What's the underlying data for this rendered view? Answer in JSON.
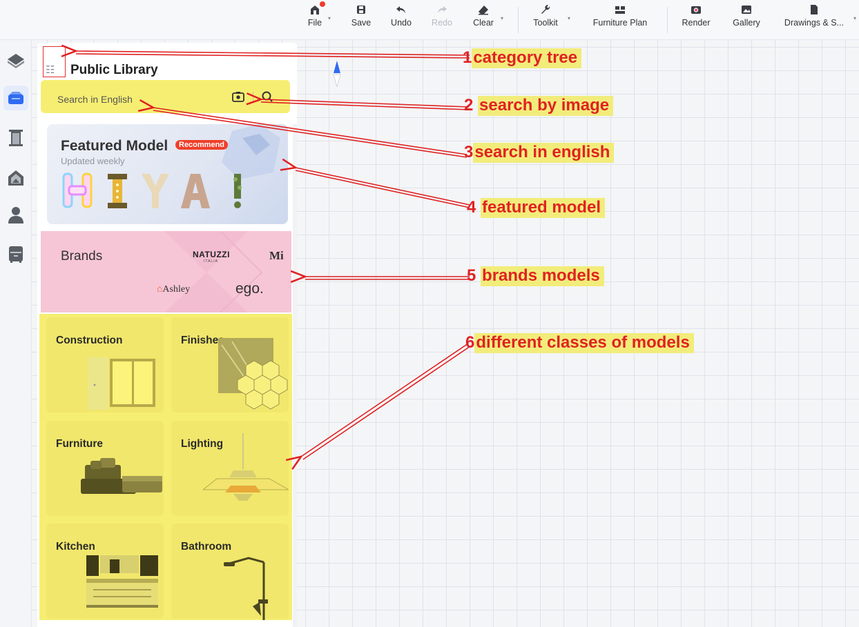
{
  "toolbar": {
    "items": [
      {
        "label": "File",
        "icon": "house-file-icon"
      },
      {
        "label": "Save",
        "icon": "floppy-save-icon"
      },
      {
        "label": "Undo",
        "icon": "undo-arrow-icon"
      },
      {
        "label": "Redo",
        "icon": "redo-arrow-icon",
        "disabled": true
      },
      {
        "label": "Clear",
        "icon": "eraser-icon"
      },
      {
        "label": "Toolkit",
        "icon": "wrench-icon"
      },
      {
        "label": "Furniture Plan",
        "icon": "plan-grid-icon"
      },
      {
        "label": "Render",
        "icon": "camera-icon"
      },
      {
        "label": "Gallery",
        "icon": "image-icon"
      },
      {
        "label": "Drawings & S...",
        "icon": "document-icon"
      }
    ]
  },
  "rail": {
    "items": [
      {
        "icon": "cube-shape-icon"
      },
      {
        "icon": "library-box-icon",
        "active": true
      },
      {
        "icon": "door-icon"
      },
      {
        "icon": "house-outline-icon"
      },
      {
        "icon": "person-icon"
      },
      {
        "icon": "cabinet-icon"
      }
    ]
  },
  "library": {
    "title": "Public Library",
    "search_placeholder": "Search in English",
    "featured": {
      "title": "Featured Model",
      "badge": "Recommend",
      "subtitle": "Updated weekly",
      "letters": [
        "H",
        "I",
        "Y",
        "A",
        "!"
      ]
    },
    "brands": {
      "title": "Brands",
      "logos": [
        "NATUZZI",
        "ITALIA",
        "Mi",
        "Ashley",
        "ego."
      ]
    },
    "categories": [
      {
        "label": "Construction"
      },
      {
        "label": "Finishes"
      },
      {
        "label": "Furniture"
      },
      {
        "label": "Lighting"
      },
      {
        "label": "Kitchen"
      },
      {
        "label": "Bathroom"
      }
    ]
  },
  "annotations": [
    {
      "num": "1",
      "text": "category tree"
    },
    {
      "num": "2",
      "text": "search by image"
    },
    {
      "num": "3",
      "text": "search in english"
    },
    {
      "num": "4",
      "text": "featured model"
    },
    {
      "num": "5",
      "text": "brands models"
    },
    {
      "num": "6",
      "text": "different classes of models"
    }
  ],
  "colors": {
    "highlight_yellow": "#f6ee72",
    "brands_pink": "#f6c6d6",
    "annotation_red": "#e02222",
    "accent_blue": "#2f6bf2"
  }
}
